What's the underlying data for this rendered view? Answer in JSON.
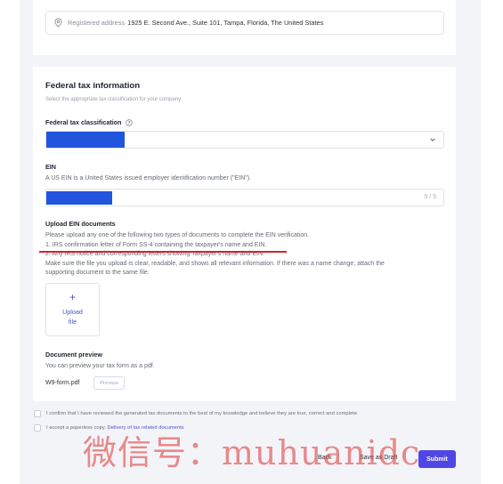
{
  "address": {
    "label": "Registered address",
    "value": "1925 E. Second Ave., Suite 101, Tampa, Florida, The United States"
  },
  "federal_tax": {
    "title": "Federal tax information",
    "subtitle": "Select the appropriate tax classification for your company.",
    "classification_label": "Federal tax classification",
    "classification_icon": "info-circle-icon"
  },
  "ein": {
    "label": "EIN",
    "description": "A US EIN is a United States issued employer identification number (\"EIN\").",
    "count": "9 / 9"
  },
  "upload": {
    "title": "Upload EIN documents",
    "line1": "Please upload any one of the following two types of documents to complete the EIN verification.",
    "line2": "1. IRS confirmation letter of Form SS-4 containing the taxpayer's name and EIN.",
    "line3": "2. Any IRS notice and corresponding letters showing Taxpayer's name and EIN.",
    "line4": "Make sure the file you upload is clear, readable, and shows all relevant information. If there was a name change, attach the",
    "line5": "supporting document to the same file.",
    "button_plus": "+",
    "button_line1": "Upload",
    "button_line2": "file"
  },
  "preview": {
    "title": "Document preview",
    "description": "You can preview your tax form as a pdf.",
    "file_name": "W9-form.pdf",
    "button": "Preview"
  },
  "checks": {
    "confirm": "I confirm that I have reviewed the generated tax documents to the best of my knowledge and believe they are true, correct and complete.",
    "paperless_prefix": "I accept a paperless copy.",
    "paperless_link": "Delivery of tax related documents"
  },
  "footer": {
    "back": "Back",
    "save_draft": "Save as Draft",
    "submit": "Submit"
  },
  "watermark": "微信号：muhuanidc",
  "colors": {
    "accent": "#4f46e5",
    "redaction": "#2255dd",
    "annotation": "#d1242f"
  }
}
